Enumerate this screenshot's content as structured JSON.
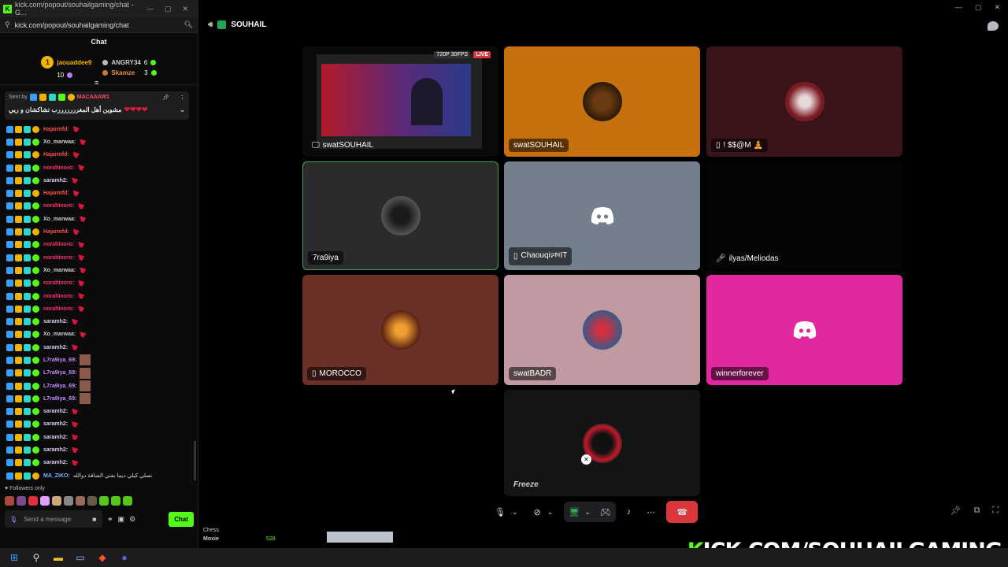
{
  "browser": {
    "tab_title": "kick.com/popout/souhailgaming/chat - G...",
    "url": "kick.com/popout/souhailgaming/chat"
  },
  "chat": {
    "title": "Chat",
    "top_left": {
      "name": "jaouaddee9",
      "rank": "1",
      "count": "10"
    },
    "top_right": [
      {
        "name": "ANGRY34",
        "count": "6"
      },
      {
        "name": "Skamze",
        "count": "3"
      }
    ],
    "pinned": {
      "sent_by": "Sent by",
      "user": "MACAAAW1",
      "text": "مشوين أهل المغرررررررب تشاكشان و ريي"
    },
    "messages": [
      {
        "user": "Hajarmfd:",
        "color": "#ff4d4d",
        "text": ""
      },
      {
        "user": "Xo_marwaa:",
        "color": "#cfcfcf",
        "text": ""
      },
      {
        "user": "Hajarmfd:",
        "color": "#ff4d4d",
        "text": ""
      },
      {
        "user": "noraltinoro:",
        "color": "#ff2f6b",
        "text": ""
      },
      {
        "user": "saramh2:",
        "color": "#d8c8f0",
        "text": ""
      },
      {
        "user": "Hajarmfd:",
        "color": "#ff4d4d",
        "text": ""
      },
      {
        "user": "noraltinoro:",
        "color": "#ff2f6b",
        "text": ""
      },
      {
        "user": "Xo_marwaa:",
        "color": "#cfcfcf",
        "text": ""
      },
      {
        "user": "Hajarmfd:",
        "color": "#ff4d4d",
        "text": ""
      },
      {
        "user": "noraltinoro:",
        "color": "#ff2f6b",
        "text": ""
      },
      {
        "user": "noraltinoro:",
        "color": "#ff2f6b",
        "text": ""
      },
      {
        "user": "Xo_marwaa:",
        "color": "#cfcfcf",
        "text": ""
      },
      {
        "user": "noraltinoro:",
        "color": "#ff2f6b",
        "text": ""
      },
      {
        "user": "noraltinoro:",
        "color": "#ff2f6b",
        "text": ""
      },
      {
        "user": "noraltinoro:",
        "color": "#ff2f6b",
        "text": ""
      },
      {
        "user": "saramh2:",
        "color": "#d8c8f0",
        "text": ""
      },
      {
        "user": "Xo_marwaa:",
        "color": "#cfcfcf",
        "text": ""
      },
      {
        "user": "saramh2:",
        "color": "#d8c8f0",
        "text": ""
      },
      {
        "user": "L7ra9iya_69:",
        "color": "#c38cff",
        "text": ""
      },
      {
        "user": "L7ra9iya_69:",
        "color": "#c38cff",
        "text": ""
      },
      {
        "user": "L7ra9iya_69:",
        "color": "#c38cff",
        "text": ""
      },
      {
        "user": "L7ra9iya_69:",
        "color": "#c38cff",
        "text": ""
      },
      {
        "user": "saramh2:",
        "color": "#d8c8f0",
        "text": ""
      },
      {
        "user": "saramh2:",
        "color": "#d8c8f0",
        "text": ""
      },
      {
        "user": "saramh2:",
        "color": "#d8c8f0",
        "text": ""
      },
      {
        "user": "saramh2:",
        "color": "#d8c8f0",
        "text": ""
      },
      {
        "user": "saramh2:",
        "color": "#d8c8f0",
        "text": ""
      },
      {
        "user": "MA_ZIKO:",
        "color": "#7fb0ff",
        "text": "تصلي كيلي ديما بفني الشاقة دوالله"
      }
    ],
    "followers_only": "Followers only",
    "input_placeholder": "Send a message",
    "send_label": "Chat"
  },
  "discord": {
    "channel": "SOUHAIL",
    "tiles": [
      {
        "name": "swatSOUHAIL",
        "stream_badge": "720P 30FPS",
        "live": "LIVE"
      },
      {
        "name": "swatSOUHAIL"
      },
      {
        "name": "! $$@M 🧘"
      },
      {
        "name": "7ra9iya"
      },
      {
        "name": "Chaouqi🕬IT"
      },
      {
        "name": "ilyas/Meliodas"
      },
      {
        "name": "MOROCCO"
      },
      {
        "name": "swatBADR"
      },
      {
        "name": "winnerforever"
      },
      {
        "name": "Freeze"
      }
    ]
  },
  "under_text": {
    "game": "Chess",
    "user": "Moxie",
    "viewers": "528"
  },
  "branding": {
    "prefix": "K",
    "rest": "ICK.COM/SOUHAILGAMING"
  },
  "colors": {
    "kick_green": "#53fc18",
    "discord_red": "#da373c",
    "discord_blurple": "#5865f2",
    "pink_tile": "#e2289f",
    "orange_tile": "#c6700f"
  }
}
